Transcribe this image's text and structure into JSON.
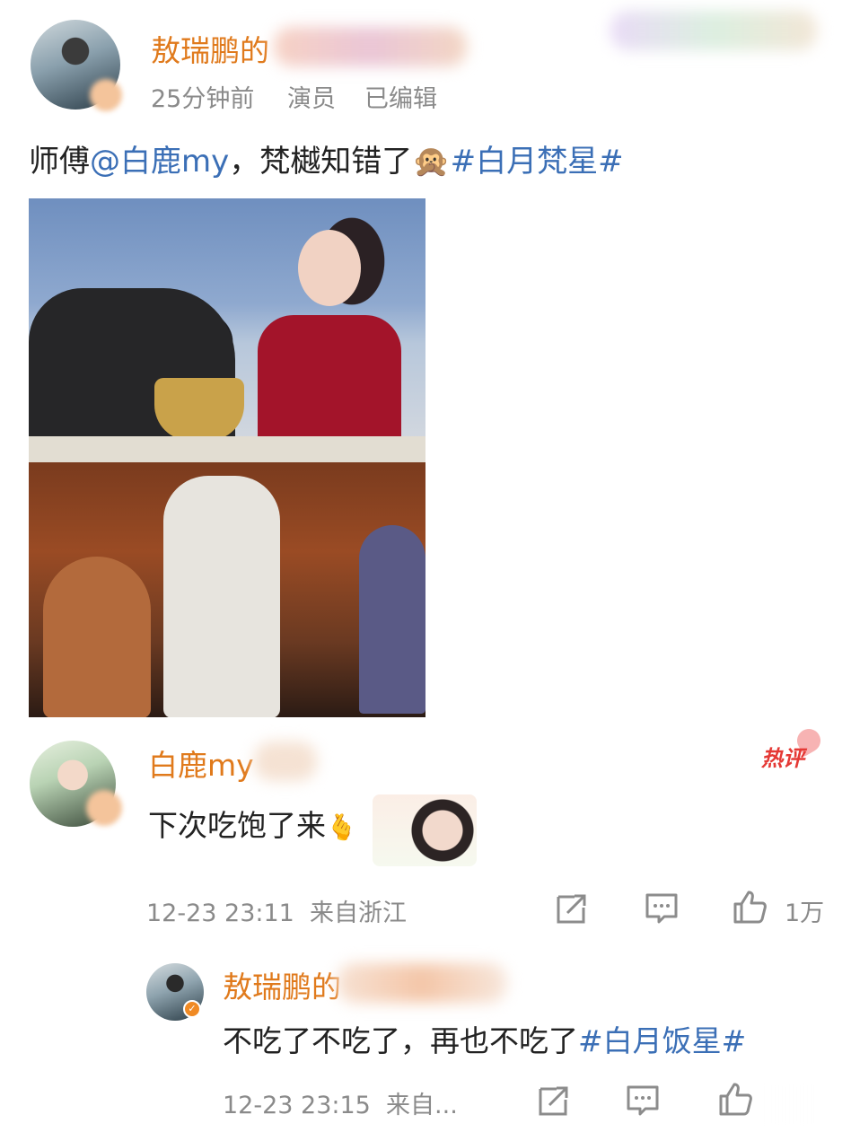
{
  "post": {
    "author": "敖瑞鹏的",
    "time": "25分钟前",
    "tag": "演员",
    "edited": "已编辑",
    "text_prefix": "师傅",
    "mention": "@白鹿my",
    "text_middle": "，梵樾知错了",
    "emoji": "🙊",
    "topic": "#白月梵星#"
  },
  "comment": {
    "author": "白鹿my",
    "hot_label": "热评",
    "text": "下次吃饱了来",
    "emoji": "🫰",
    "time": "12-23 23:11",
    "location": "来自浙江",
    "like_count": "1万"
  },
  "reply": {
    "author": "敖瑞鹏的",
    "text": "不吃了不吃了，再也不吃了",
    "topic": "#白月饭星#",
    "time": "12-23 23:15",
    "location": "来自..."
  },
  "icons": {
    "share": "share-icon",
    "comment": "comment-icon",
    "like": "thumbs-up-icon",
    "verify": "verified-badge-icon"
  },
  "colors": {
    "name": "#e07a1c",
    "link": "#3b6fb6",
    "meta": "#8a8a8a",
    "hot": "#e53935"
  }
}
